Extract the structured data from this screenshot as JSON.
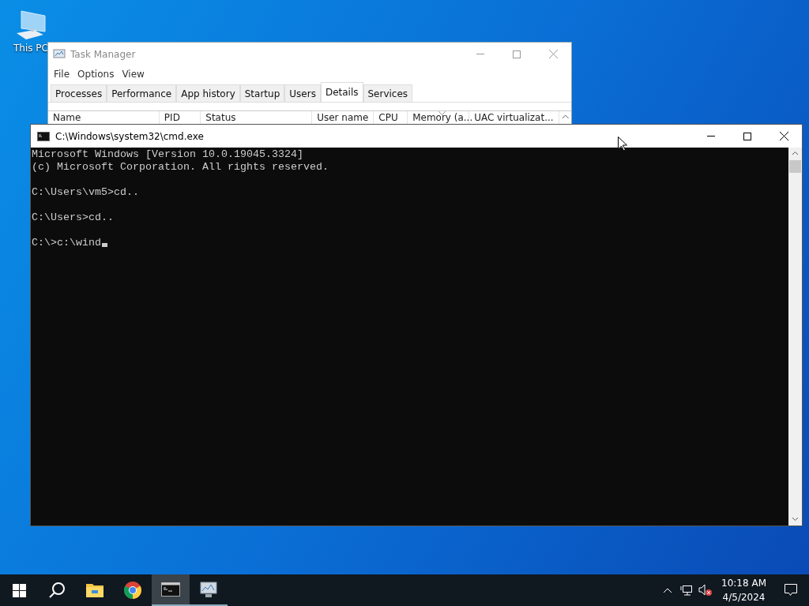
{
  "desktop": {
    "icons": [
      {
        "kind": "computer",
        "label": "This PC"
      }
    ]
  },
  "task_manager": {
    "title": "Task Manager",
    "menu": [
      "File",
      "Options",
      "View"
    ],
    "tabs": [
      {
        "label": "Processes",
        "selected": false
      },
      {
        "label": "Performance",
        "selected": false
      },
      {
        "label": "App history",
        "selected": false
      },
      {
        "label": "Startup",
        "selected": false
      },
      {
        "label": "Users",
        "selected": false
      },
      {
        "label": "Details",
        "selected": true
      },
      {
        "label": "Services",
        "selected": false
      }
    ],
    "columns": [
      {
        "label": "Name",
        "sorted": false
      },
      {
        "label": "PID",
        "sorted": false
      },
      {
        "label": "Status",
        "sorted": false
      },
      {
        "label": "User name",
        "sorted": false
      },
      {
        "label": "CPU",
        "sorted": false
      },
      {
        "label": "Memory (a...",
        "sorted": true
      },
      {
        "label": "UAC virtualizat...",
        "sorted": false
      }
    ]
  },
  "console": {
    "title": "C:\\Windows\\system32\\cmd.exe",
    "blocks": [
      [
        "Microsoft Windows [Version 10.0.19045.3324]",
        "(c) Microsoft Corporation. All rights reserved."
      ],
      [
        "C:\\Users\\vm5>cd.."
      ],
      [
        "C:\\Users>cd.."
      ],
      [
        "C:\\>c:\\wind"
      ]
    ]
  },
  "taskbar": {
    "apps": [
      {
        "kind": "explorer",
        "running": false,
        "active": false
      },
      {
        "kind": "chrome",
        "running": false,
        "active": false
      },
      {
        "kind": "console",
        "running": true,
        "active": true
      },
      {
        "kind": "taskmgr",
        "running": true,
        "active": false
      }
    ],
    "tray": {
      "volume_muted": true
    },
    "clock": {
      "time": "10:18 AM",
      "date": "4/5/2024"
    }
  }
}
